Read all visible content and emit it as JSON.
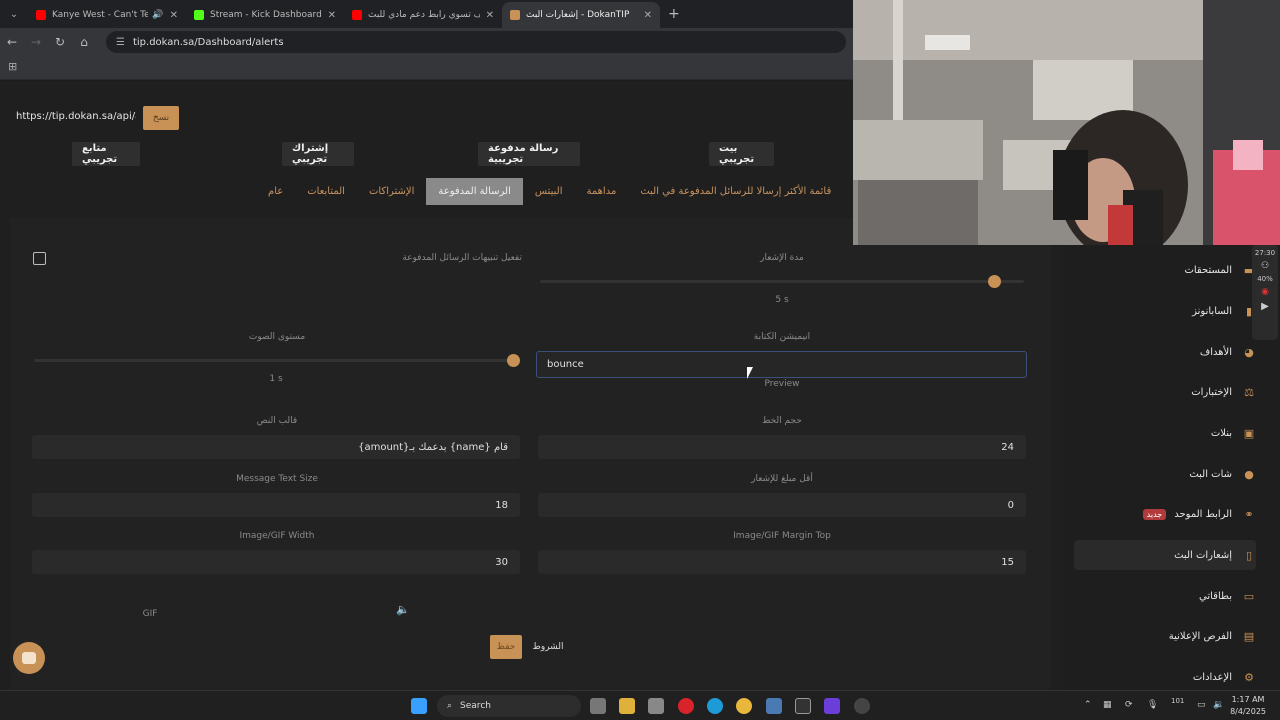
{
  "browser": {
    "tabs": [
      {
        "title": "Kanye West - Can't Tell Me",
        "favicon_color": "#ff0000"
      },
      {
        "title": "Stream - Kick Dashboard",
        "favicon_color": "#53fc18"
      },
      {
        "title": "كيف تسوي رابط دعم مادي للبث",
        "favicon_color": "#ff0000"
      },
      {
        "title": "إشعارات البث - DokanTIP",
        "favicon_color": "#c89156"
      }
    ],
    "new_tab": "+",
    "url": "tip.dokan.sa/Dashboard/alerts"
  },
  "page": {
    "api_url": "https://tip.dokan.sa/api/ale",
    "copy_label": "نسخ",
    "test_buttons": {
      "tip": "بيت تجريبي",
      "paid": "رسالة مدفوعة تجريبية",
      "sub": "إشتراك تجريبي",
      "follow": "متابع تجريبي"
    },
    "tabs": [
      "قائمة الأكثر إرسالا للرسائل المدفوعة في البث",
      "مداهمة",
      "البيتس",
      "الرسالة المدفوعة",
      "الإشتراكات",
      "المتابعات",
      "عام"
    ],
    "active_tab": "الرسالة المدفوعة",
    "form": {
      "enable_label": "تفعيل تنبيهات الرسائل المدفوعة",
      "duration_label": "مدة الإشعار",
      "duration_value": "5 s",
      "duration_level": 0.94,
      "volume_label": "مستوى الصوت",
      "volume_value": "1 s",
      "volume_level": 0.99,
      "animation_label": "انيميشن الكتابة",
      "animation_value": "bounce",
      "preview_label": "Preview",
      "font_size_label": "حجم الخط",
      "font_size_value": "24",
      "template_label": "قالب النص",
      "template_value": "{amount}بدعمك بـ {name} قام",
      "min_amount_label": "أقل مبلغ للإشعار",
      "min_amount_value": "0",
      "msg_text_size_label": "Message Text Size",
      "msg_text_size_value": "18",
      "img_margin_label": "Image/GIF Margin Top",
      "img_margin_value": "15",
      "img_width_label": "Image/GIF Width",
      "img_width_value": "30",
      "gif_label": "GIF"
    },
    "save_label": "حفظ",
    "terms_label": "الشروط"
  },
  "sidebar": {
    "items": [
      {
        "label": "المستحقات",
        "icon": "wallet-icon"
      },
      {
        "label": "السابانونز",
        "icon": "file-icon"
      },
      {
        "label": "الأهداف",
        "icon": "pie-icon"
      },
      {
        "label": "الإختبارات",
        "icon": "scale-icon"
      },
      {
        "label": "بنلات",
        "icon": "panel-icon"
      },
      {
        "label": "شات البث",
        "icon": "chat-icon"
      },
      {
        "label": "الرابط الموحد",
        "icon": "link-icon",
        "badge": "جديد"
      },
      {
        "label": "إشعارات البث",
        "icon": "phone-icon",
        "active": true
      },
      {
        "label": "بطاقاتي",
        "icon": "card-icon"
      },
      {
        "label": "الفرص الإعلانية",
        "icon": "ticket-icon"
      },
      {
        "label": "الإعدادات",
        "icon": "gear-icon"
      }
    ]
  },
  "overlay": {
    "time": "27:30",
    "percent": "40%"
  },
  "taskbar": {
    "search_label": "Search",
    "time": "1:17 AM",
    "date": "8/4/2025",
    "tray_text": "101"
  },
  "colors": {
    "accent": "#c89156",
    "page_bg": "#1f1f1f",
    "panel_bg": "#222222"
  }
}
